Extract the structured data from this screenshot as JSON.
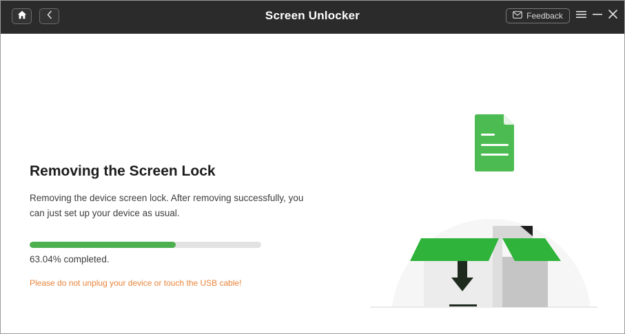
{
  "app": {
    "title": "Screen Unlocker",
    "feedback_label": "Feedback",
    "icons": {
      "home": "home-icon",
      "back": "chevron-left-icon",
      "feedback": "mail-icon",
      "menu": "hamburger-menu-icon",
      "minimize": "minimize-icon",
      "close": "close-icon"
    }
  },
  "main": {
    "heading": "Removing the Screen Lock",
    "description": "Removing the device screen lock. After removing successfully, you can just set up your device as usual.",
    "progress": {
      "percent": 63.04,
      "label": "63.04% completed."
    },
    "warning": "Please do not unplug your device or touch the USB cable!"
  },
  "colors": {
    "titlebar": "#2b2b2b",
    "accent_green": "#4caf50",
    "warning_orange": "#e8833a",
    "progress_track": "#e2e2e2"
  }
}
